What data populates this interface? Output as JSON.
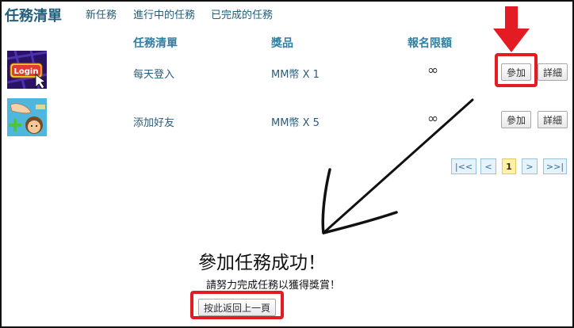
{
  "header": {
    "title": "任務清單",
    "tabs": [
      "新任務",
      "進行中的任務",
      "已完成的任務"
    ]
  },
  "table": {
    "columns": [
      "任務清單",
      "獎品",
      "報名限額"
    ],
    "rows": [
      {
        "name": "每天登入",
        "prize": "MM幣 X 1",
        "quota": "∞",
        "join_label": "參加",
        "detail_label": "詳細",
        "thumb_label": "Login"
      },
      {
        "name": "添加好友",
        "prize": "MM幣 X 5",
        "quota": "∞",
        "join_label": "參加",
        "detail_label": "詳細"
      }
    ]
  },
  "pagination": {
    "first": "|<<",
    "prev": "<",
    "current": "1",
    "next": ">",
    "last": ">>|"
  },
  "message": {
    "title": "參加任務成功！",
    "subtitle": "請努力完成任務以獲得獎賞！",
    "back_label": "按此返回上一頁"
  },
  "colors": {
    "highlight": "#e31b23",
    "title": "#235f7a",
    "header_col": "#2f7fa3",
    "page_current": "#fff2a8"
  }
}
